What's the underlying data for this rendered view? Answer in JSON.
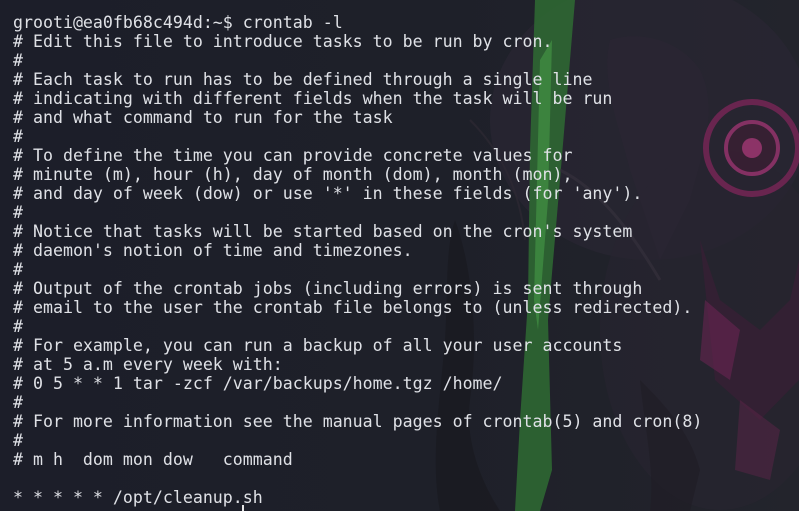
{
  "terminal": {
    "prompt_line": "grooti@ea0fb68c494d:~$ crontab -l",
    "lines": [
      "# Edit this file to introduce tasks to be run by cron.",
      "#",
      "# Each task to run has to be defined through a single line",
      "# indicating with different fields when the task will be run",
      "# and what command to run for the task",
      "#",
      "# To define the time you can provide concrete values for",
      "# minute (m), hour (h), day of month (dom), month (mon),",
      "# and day of week (dow) or use '*' in these fields (for 'any').",
      "#",
      "# Notice that tasks will be started based on the cron's system",
      "# daemon's notion of time and timezones.",
      "#",
      "# Output of the crontab jobs (including errors) is sent through",
      "# email to the user the crontab file belongs to (unless redirected).",
      "#",
      "# For example, you can run a backup of all your user accounts",
      "# at 5 a.m every week with:",
      "# 0 5 * * 1 tar -zcf /var/backups/home.tgz /home/",
      "#",
      "# For more information see the manual pages of crontab(5) and cron(8)",
      "#",
      "# m h  dom mon dow   command",
      "",
      "* * * * * /opt/cleanup.sh"
    ]
  },
  "colors": {
    "background": "#1c1e29",
    "text": "#dfe1e6",
    "wallpaper_green": "#3f9a3c",
    "wallpaper_magenta": "#8b2a63"
  }
}
